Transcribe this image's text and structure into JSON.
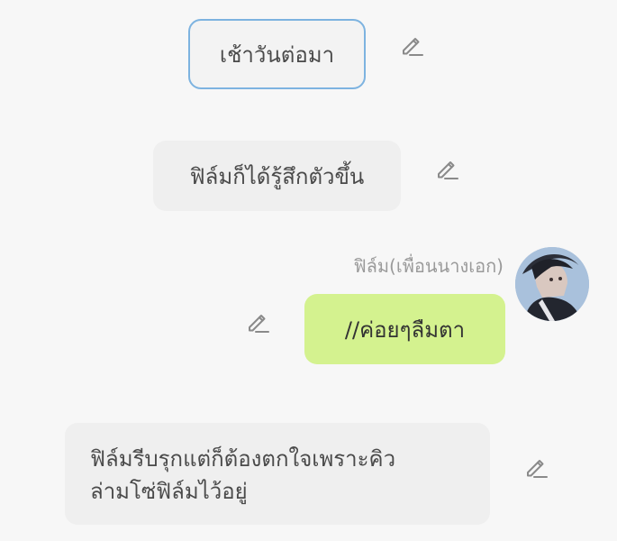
{
  "messages": [
    {
      "text": "เช้าวันต่อมา"
    },
    {
      "text": "ฟิล์มก็ได้รู้สึกตัวขึ้น"
    },
    {
      "speaker": "ฟิล์ม(เพื่อนนางเอก)",
      "text": "//ค่อยๆลืมตา"
    },
    {
      "text_line1": "ฟิล์มรีบรุกแต่ก็ต้องตกใจเพราะคิว",
      "text_line2": "ล่ามโซ่ฟิล์มไว้อยู่"
    }
  ],
  "colors": {
    "background": "#f7f7f7",
    "bubble": "#efefef",
    "selected_border": "#7db3e0",
    "character_bubble": "#d4f28f",
    "icon": "#8a8a8a"
  },
  "icons": {
    "edit": "pencil-edit-icon"
  }
}
